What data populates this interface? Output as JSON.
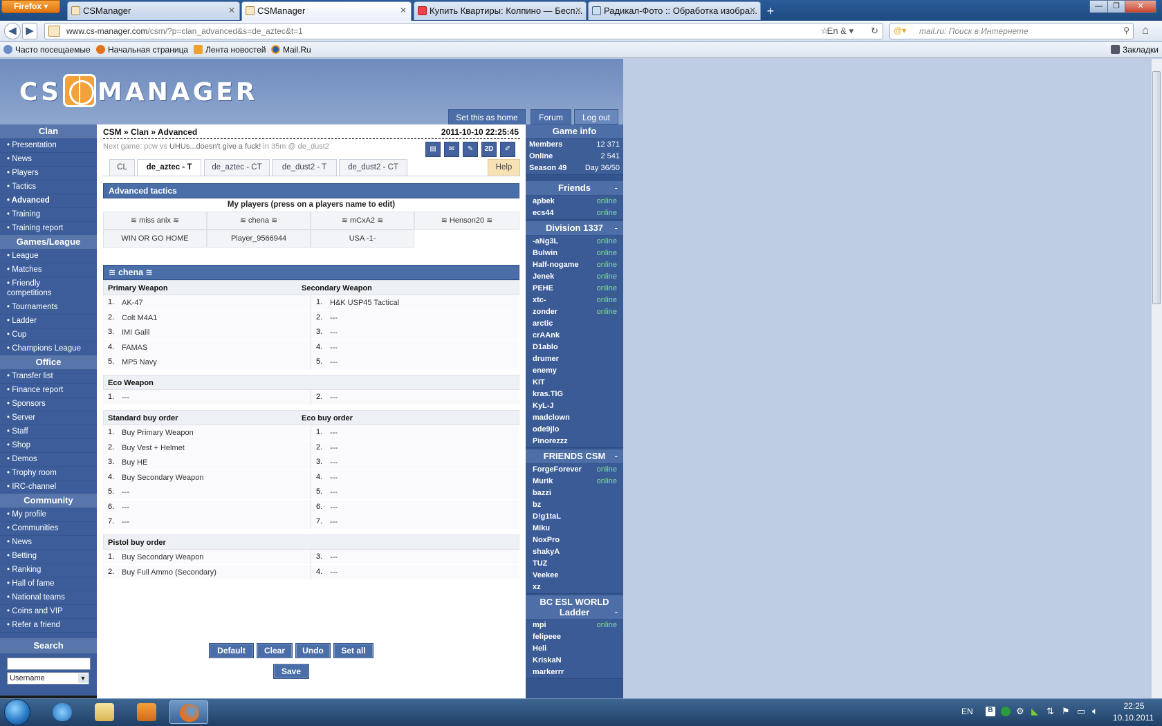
{
  "browser": {
    "firefox_label": "Firefox",
    "tabs": [
      {
        "label": "CSManager"
      },
      {
        "label": "CSManager"
      },
      {
        "label": "Купить Квартиры: Колпино — Бесп..."
      },
      {
        "label": "Радикал-Фото :: Обработка изобра..."
      }
    ],
    "url_host": "www.cs-manager.com",
    "url_path": "/csm/?p=clan_advanced&s=de_aztec&t=1",
    "search_placeholder": "mail.ru: Поиск в Интернете",
    "bookmarks": [
      "Часто посещаемые",
      "Начальная страница",
      "Лента новостей",
      "Mail.Ru"
    ],
    "bookmarks_menu": "Закладки"
  },
  "site": {
    "logo": "CS MANAGER",
    "top_buttons": [
      "Set this as home",
      "Forum",
      "Log out"
    ]
  },
  "leftnav": {
    "sections": [
      {
        "title": "Clan",
        "items": [
          "• Presentation",
          "• News",
          "• Players",
          "• Tactics",
          "• Advanced",
          "• Training",
          "• Training report"
        ]
      },
      {
        "title": "Games/League",
        "items": [
          "• League",
          "• Matches",
          "• Friendly competitions",
          "• Tournaments",
          "• Ladder",
          "• Cup",
          "• Champions League"
        ]
      },
      {
        "title": "Office",
        "items": [
          "• Transfer list",
          "• Finance report",
          "• Sponsors",
          "• Server",
          "• Staff",
          "• Shop",
          "• Demos",
          "• Trophy room",
          "• IRC-channel"
        ]
      },
      {
        "title": "Community",
        "items": [
          "• My profile",
          "• Communities",
          "• News",
          "• Betting",
          "• Ranking",
          "• Hall of fame",
          "• National teams",
          "• Coins and VIP",
          "• Refer a friend"
        ]
      }
    ],
    "search_title": "Search",
    "search_select": "Username"
  },
  "main": {
    "breadcrumb": "CSM » Clan » Advanced",
    "datetime": "2011-10-10 22:25:45",
    "nextgame_prefix": "Next game: pcw vs ",
    "nextgame_team": "UHUs...doesn't give a fuck!",
    "nextgame_suffix": " in 35m @ de_dust2",
    "tool_icons": [
      "book-icon",
      "mail-icon",
      "tag-icon",
      "2d-icon",
      "note-icon"
    ],
    "tool_2d": "2D",
    "tabs": [
      "CL",
      "de_aztec - T",
      "de_aztec - CT",
      "de_dust2 - T",
      "de_dust2 - CT"
    ],
    "help": "Help",
    "advanced_title": "Advanced tactics",
    "my_players_title": "My players (press on a players name to edit)",
    "players": [
      "≋ miss anix ≋",
      "≋ chena ≋",
      "≋ mCxA2 ≋",
      "≋ Henson20 ≋",
      "WIN OR GO HOME",
      "Player_9566944",
      "USA -1-"
    ],
    "selected_player": "≋ chena ≋",
    "primary_label": "Primary Weapon",
    "secondary_label": "Secondary Weapon",
    "primary": [
      "AK-47",
      "Colt M4A1",
      "IMI Galil",
      "FAMAS",
      "MP5 Navy"
    ],
    "secondary": [
      "H&K USP45 Tactical",
      "---",
      "---",
      "---",
      "---"
    ],
    "eco_label": "Eco Weapon",
    "eco": [
      "---",
      "---"
    ],
    "std_label": "Standard buy order",
    "eco_buy_label": "Eco buy order",
    "std_order": [
      "Buy Primary Weapon",
      "Buy Vest + Helmet",
      "Buy HE",
      "Buy Secondary Weapon",
      "---",
      "---",
      "---"
    ],
    "eco_order": [
      "---",
      "---",
      "---",
      "---",
      "---",
      "---",
      "---"
    ],
    "pistol_label": "Pistol buy order",
    "pistol_left": [
      "Buy Secondary Weapon",
      "Buy Full Ammo (Secondary)"
    ],
    "pistol_right": [
      "---",
      "---"
    ],
    "buttons": [
      "Default",
      "Clear",
      "Undo",
      "Set all"
    ],
    "save": "Save"
  },
  "rightcol": {
    "game_info_title": "Game info",
    "game_info": [
      [
        "Members",
        "12 371"
      ],
      [
        "Online",
        "2 541"
      ],
      [
        "Season 49",
        "Day 36/50"
      ]
    ],
    "groups": [
      {
        "title": "Friends",
        "toggle": "-",
        "members": [
          [
            "apbek",
            "online"
          ],
          [
            "ecs44",
            "online"
          ]
        ]
      },
      {
        "title": "Division 1337",
        "toggle": "-",
        "members": [
          [
            "-aNg3L",
            "online"
          ],
          [
            "Bulwin",
            "online"
          ],
          [
            "Half-nogame",
            "online"
          ],
          [
            "Jenek",
            "online"
          ],
          [
            "PEHE",
            "online"
          ],
          [
            "xtc-",
            "online"
          ],
          [
            "zonder",
            "online"
          ],
          [
            "arctic",
            ""
          ],
          [
            "crAAnk",
            ""
          ],
          [
            "D1ablo",
            ""
          ],
          [
            "drumer",
            ""
          ],
          [
            "enemy",
            ""
          ],
          [
            "KIT",
            ""
          ],
          [
            "kras.TIG",
            ""
          ],
          [
            "KyL-J",
            ""
          ],
          [
            "madclown",
            ""
          ],
          [
            "ode9jlo",
            ""
          ],
          [
            "Pinorezzz",
            ""
          ]
        ]
      },
      {
        "title": "FRIENDS CSM",
        "toggle": "-",
        "members": [
          [
            "ForgeForever",
            "online"
          ],
          [
            "Murik",
            "online"
          ],
          [
            "bazzi",
            ""
          ],
          [
            "bz",
            ""
          ],
          [
            "D!g1taL",
            ""
          ],
          [
            "Miku",
            ""
          ],
          [
            "NoxPro",
            ""
          ],
          [
            "shakyA",
            ""
          ],
          [
            "TUZ",
            ""
          ],
          [
            "Veekee",
            ""
          ],
          [
            "xz",
            ""
          ]
        ]
      },
      {
        "title": "BC ESL WORLD Ladder",
        "toggle": "-",
        "members": [
          [
            "mpi",
            "online"
          ],
          [
            "felipeee",
            ""
          ],
          [
            "Heli",
            ""
          ],
          [
            "KriskaN",
            ""
          ],
          [
            "markerrr",
            ""
          ]
        ]
      }
    ]
  },
  "taskbar": {
    "lang": "EN",
    "time": "22:25",
    "date": "10.10.2011"
  }
}
